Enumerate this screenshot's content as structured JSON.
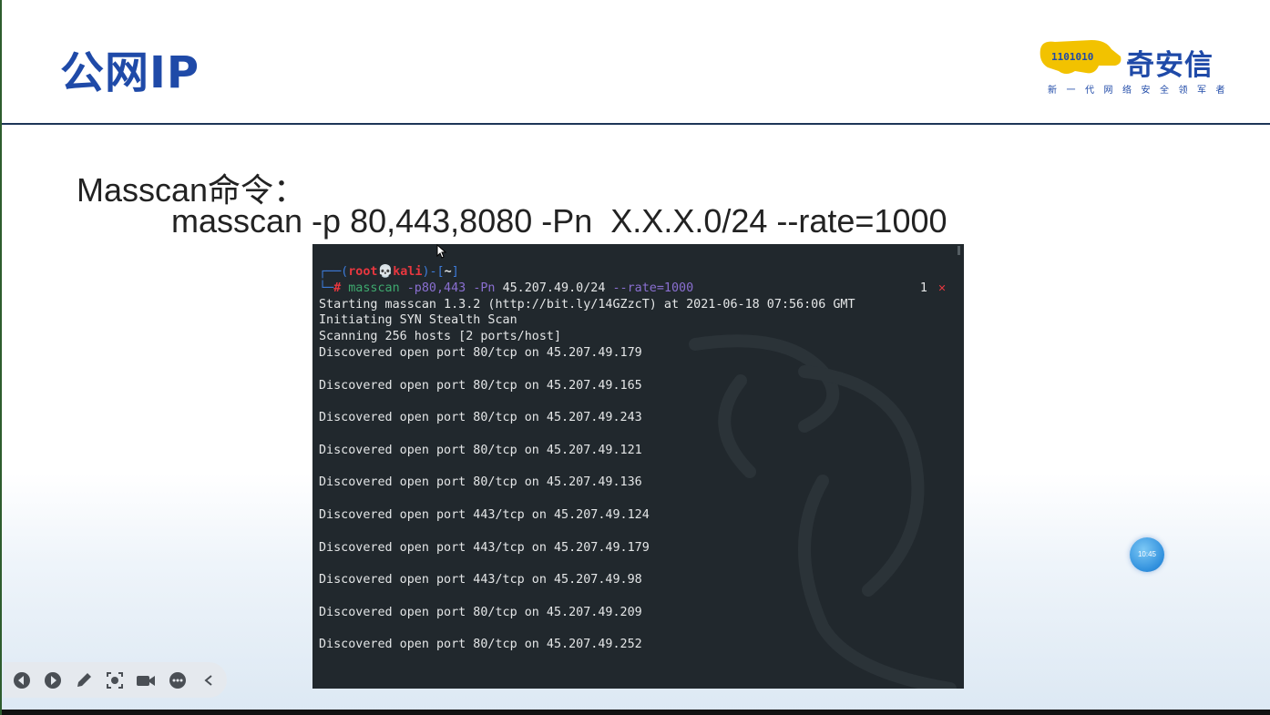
{
  "slide": {
    "title": "公网IP",
    "logo": {
      "name": "奇安信",
      "tagline": "新一代网络安全领军者",
      "mark_digits": "1101010"
    },
    "command_label": "Masscan命令：",
    "command_line": "masscan -p 80,443,8080 -Pn  X.X.X.0/24 --rate=1000"
  },
  "terminal": {
    "prompt": {
      "open": "┌──(",
      "user": "root",
      "skull": "💀",
      "host": "kali",
      "mid": ")-[",
      "dir": "~",
      "close": "]",
      "corner": "└─",
      "hash": "#"
    },
    "command": {
      "name": "masscan",
      "port_arg": "-p80,443",
      "pn_arg": "-Pn",
      "target": "45.207.49.0/24",
      "rate_arg": "--rate=1000"
    },
    "exit_code": "1",
    "exit_mark": "✕",
    "output": [
      "Starting masscan 1.3.2 (http://bit.ly/14GZzcT) at 2021-06-18 07:56:06 GMT",
      "Initiating SYN Stealth Scan",
      "Scanning 256 hosts [2 ports/host]",
      "Discovered open port 80/tcp on 45.207.49.179",
      "",
      "Discovered open port 80/tcp on 45.207.49.165",
      "",
      "Discovered open port 80/tcp on 45.207.49.243",
      "",
      "Discovered open port 80/tcp on 45.207.49.121",
      "",
      "Discovered open port 80/tcp on 45.207.49.136",
      "",
      "Discovered open port 443/tcp on 45.207.49.124",
      "",
      "Discovered open port 443/tcp on 45.207.49.179",
      "",
      "Discovered open port 443/tcp on 45.207.49.98",
      "",
      "Discovered open port 80/tcp on 45.207.49.209",
      "",
      "Discovered open port 80/tcp on 45.207.49.252"
    ]
  },
  "clock_widget": {
    "time": "10:45"
  },
  "toolbar": {
    "buttons": [
      {
        "icon": "previous-icon"
      },
      {
        "icon": "next-icon"
      },
      {
        "icon": "pen-icon"
      },
      {
        "icon": "screenshot-icon"
      },
      {
        "icon": "camera-icon"
      },
      {
        "icon": "more-icon"
      },
      {
        "icon": "collapse-icon"
      }
    ]
  },
  "colors": {
    "title_blue": "#1f4aa8",
    "terminal_bg": "#21282d",
    "prompt_red": "#e8373f",
    "prompt_blue": "#3d7bd9",
    "command_green": "#3ea96e",
    "arg_purple": "#8a6fd1",
    "logo_yellow": "#f2c200"
  }
}
